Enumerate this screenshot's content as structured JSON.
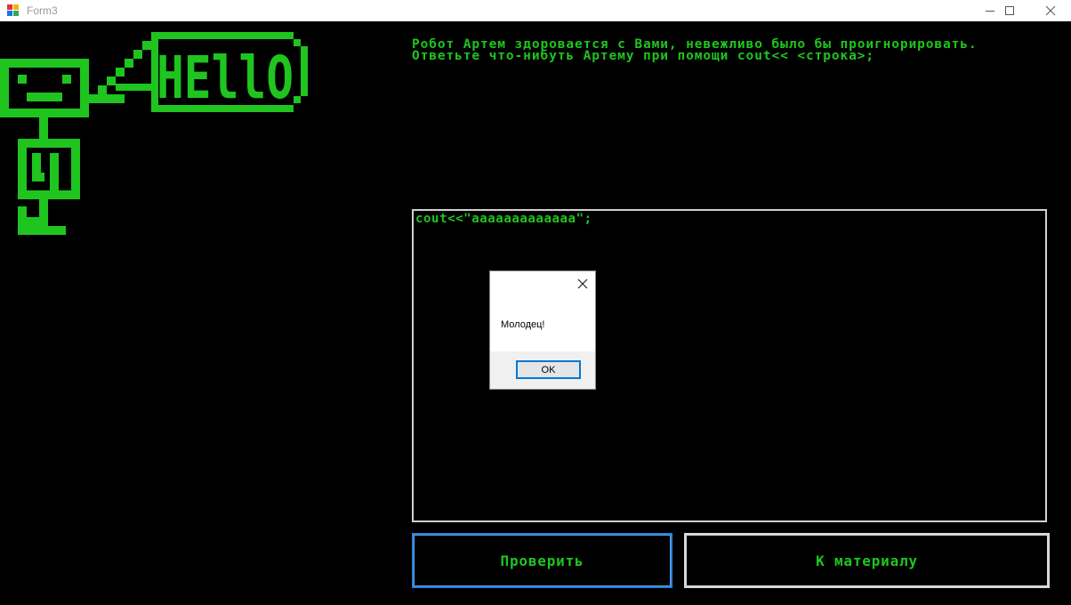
{
  "window": {
    "title": "Form3",
    "icon": "winforms-app-icon",
    "controls": [
      "minimize-icon",
      "maximize-icon",
      "close-icon"
    ]
  },
  "robot": {
    "speech_bubble_text": "HEllO",
    "color": "#1fc41f"
  },
  "instruction": {
    "text": "Робот Артем здоровается с Вами, невежливо было бы проигнорировать. Ответьте что-нибуть Артему при помощи cout<< <строка>;"
  },
  "editor": {
    "value": "cout<<\"aaaaaaaaaaaaa\";"
  },
  "buttons": {
    "check_label": "Проверить",
    "material_label": "К материалу"
  },
  "messagebox": {
    "text": "Молодец!",
    "ok_label": "OK"
  },
  "colors": {
    "background": "#000000",
    "accent_green": "#1fc41f",
    "focus_blue": "#2a7fd4"
  }
}
